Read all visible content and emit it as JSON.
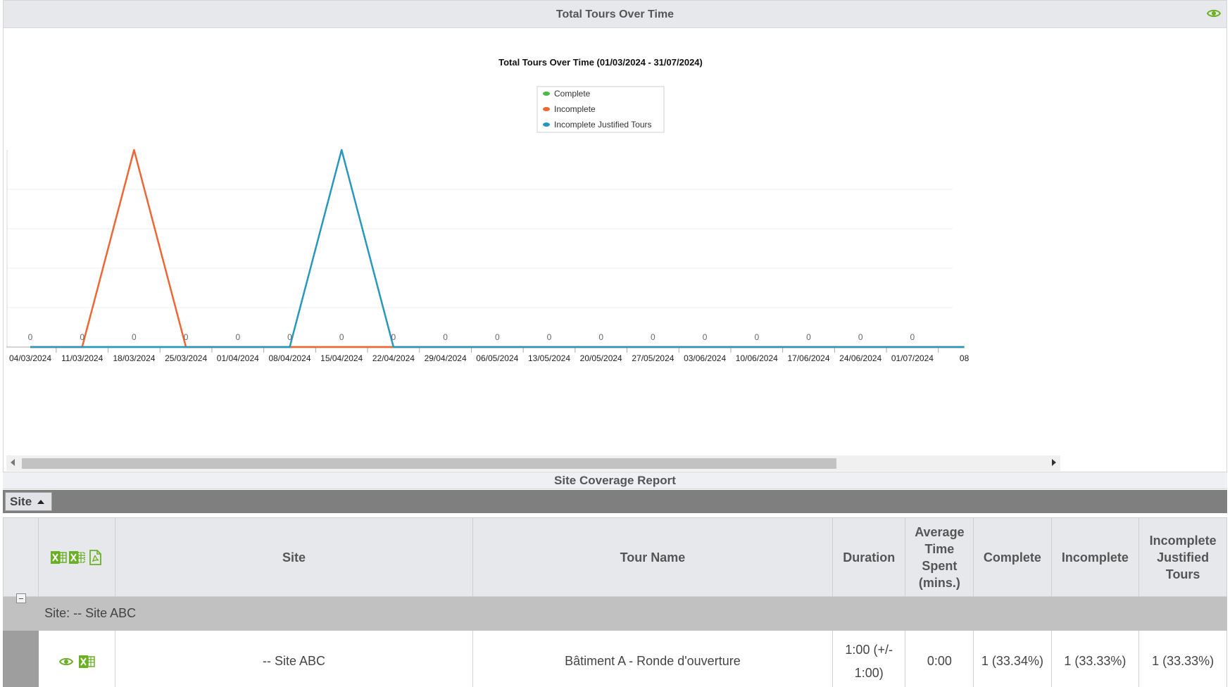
{
  "panel": {
    "title": "Total Tours Over Time"
  },
  "chart_data": {
    "type": "line",
    "title": "Total Tours Over Time (01/03/2024 - 31/07/2024)",
    "x": [
      "04/03/2024",
      "11/03/2024",
      "18/03/2024",
      "25/03/2024",
      "01/04/2024",
      "08/04/2024",
      "15/04/2024",
      "22/04/2024",
      "29/04/2024",
      "06/05/2024",
      "13/05/2024",
      "20/05/2024",
      "27/05/2024",
      "03/06/2024",
      "10/06/2024",
      "17/06/2024",
      "24/06/2024",
      "01/07/2024",
      "08"
    ],
    "series": [
      {
        "name": "Complete",
        "color": "#4db848",
        "values": [
          0,
          0,
          0,
          0,
          0,
          0,
          0,
          0,
          0,
          0,
          0,
          0,
          0,
          0,
          0,
          0,
          0,
          0,
          0
        ]
      },
      {
        "name": "Incomplete",
        "color": "#ee6633",
        "values": [
          0,
          0,
          1,
          0,
          0,
          0,
          0,
          0,
          0,
          0,
          0,
          0,
          0,
          0,
          0,
          0,
          0,
          0,
          0
        ]
      },
      {
        "name": "Incomplete Justified Tours",
        "color": "#2897c0",
        "values": [
          0,
          0,
          0,
          0,
          0,
          0,
          1,
          0,
          0,
          0,
          0,
          0,
          0,
          0,
          0,
          0,
          0,
          0,
          0
        ]
      }
    ],
    "data_labels": [
      "0",
      "0",
      "0",
      "0",
      "0",
      "0",
      "0",
      "0",
      "0",
      "0",
      "0",
      "0",
      "0",
      "0",
      "0",
      "0",
      "0",
      "0"
    ],
    "ylim": [
      0,
      1
    ],
    "grid": true,
    "legend_position": "top-center"
  },
  "report": {
    "title": "Site Coverage Report",
    "group_chip": "Site",
    "columns": [
      "Site",
      "Tour Name",
      "Duration",
      "Average Time Spent (mins.)",
      "Complete",
      "Incomplete",
      "Incomplete Justified Tours"
    ],
    "group_label": "Site: -- Site ABC",
    "rows": [
      {
        "site": "-- Site ABC",
        "tour_name": "Bâtiment A - Ronde d'ouverture",
        "duration": "1:00 (+/- 1:00)",
        "avg_time": "0:00",
        "complete": "1 (33.34%)",
        "incomplete": "1 (33.33%)",
        "justified": "1 (33.33%)"
      }
    ]
  },
  "colors": {
    "accent_green": "#6ab023",
    "header_bg": "#e6e8ec",
    "group_bar": "#7f7f7f"
  },
  "icons": [
    "eye-icon",
    "excel-icon",
    "excel-icon",
    "pdf-icon"
  ]
}
